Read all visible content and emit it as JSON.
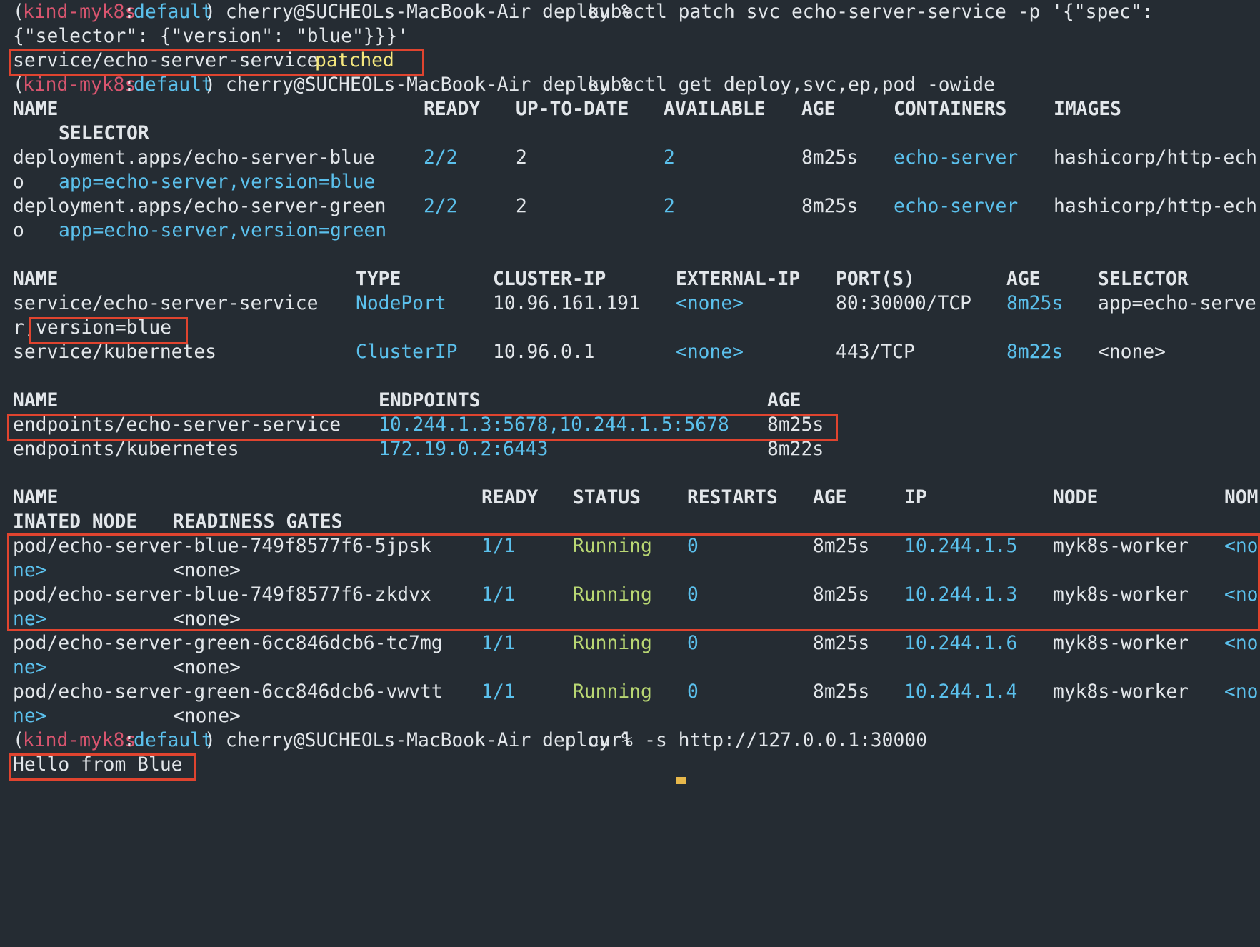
{
  "prompt": {
    "ctx_open": "(",
    "ctx_name": "kind-myk8s",
    "ctx_sep": ":",
    "ctx_ns": "default",
    "ctx_close": ")",
    "user_dir": " cherry@SUCHEOLs-MacBook-Air deploy % "
  },
  "commands": {
    "patch_line1": "kubectl patch svc echo-server-service -p '{\"spec\":",
    "patch_line2": "{\"selector\": {\"version\": \"blue\"}}}'",
    "get": "kubectl get deploy,svc,ep,pod -owide",
    "curl": "curl -s http://127.0.0.1:30000"
  },
  "patch_result": {
    "resource": "service/echo-server-service ",
    "status": "patched"
  },
  "deploy": {
    "headers": [
      "NAME",
      "READY",
      "UP-TO-DATE",
      "AVAILABLE",
      "AGE",
      "CONTAINERS",
      "IMAGES"
    ],
    "header_wrap": "SELECTOR",
    "rows": [
      {
        "name": "deployment.apps/echo-server-blue",
        "ready": "2/2",
        "uptodate": "2",
        "available": "2",
        "age": "8m25s",
        "containers": "echo-server",
        "images": "hashicorp/http-ech",
        "wrap_prefix": "o",
        "selector": "app=echo-server,version=blue"
      },
      {
        "name": "deployment.apps/echo-server-green",
        "ready": "2/2",
        "uptodate": "2",
        "available": "2",
        "age": "8m25s",
        "containers": "echo-server",
        "images": "hashicorp/http-ech",
        "wrap_prefix": "o",
        "selector": "app=echo-server,version=green"
      }
    ]
  },
  "svc": {
    "headers": [
      "NAME",
      "TYPE",
      "CLUSTER-IP",
      "EXTERNAL-IP",
      "PORT(S)",
      "AGE",
      "SELECTOR"
    ],
    "rows": [
      {
        "name": "service/echo-server-service",
        "type": "NodePort",
        "cluster_ip": "10.96.161.191",
        "external_ip": "<none>",
        "ports": "80:30000/TCP",
        "age": "8m25s",
        "selector": "app=echo-serve",
        "wrap_prefix": "r,",
        "wrap_rest": "version=blue"
      },
      {
        "name": "service/kubernetes",
        "type": "ClusterIP",
        "cluster_ip": "10.96.0.1",
        "external_ip": "<none>",
        "ports": "443/TCP",
        "age": "8m22s",
        "selector": "<none>"
      }
    ]
  },
  "ep": {
    "headers": [
      "NAME",
      "ENDPOINTS",
      "AGE"
    ],
    "rows": [
      {
        "name": "endpoints/echo-server-service",
        "endpoints": "10.244.1.3:5678,10.244.1.5:5678",
        "age": "8m25s"
      },
      {
        "name": "endpoints/kubernetes",
        "endpoints": "172.19.0.2:6443",
        "age": "8m22s"
      }
    ]
  },
  "pods": {
    "headers": [
      "NAME",
      "READY",
      "STATUS",
      "RESTARTS",
      "AGE",
      "IP",
      "NODE",
      "NOM"
    ],
    "header_wrap_1": "INATED NODE",
    "header_wrap_2": "READINESS GATES",
    "rows": [
      {
        "name": "pod/echo-server-blue-749f8577f6-5jpsk",
        "ready": "1/1",
        "status": "Running",
        "restarts": "0",
        "age": "8m25s",
        "ip": "10.244.1.5",
        "node": "myk8s-worker",
        "nominated": "<no",
        "wrap_nominated": "ne>",
        "readiness": "<none>"
      },
      {
        "name": "pod/echo-server-blue-749f8577f6-zkdvx",
        "ready": "1/1",
        "status": "Running",
        "restarts": "0",
        "age": "8m25s",
        "ip": "10.244.1.3",
        "node": "myk8s-worker",
        "nominated": "<no",
        "wrap_nominated": "ne>",
        "readiness": "<none>"
      },
      {
        "name": "pod/echo-server-green-6cc846dcb6-tc7mg",
        "ready": "1/1",
        "status": "Running",
        "restarts": "0",
        "age": "8m25s",
        "ip": "10.244.1.6",
        "node": "myk8s-worker",
        "nominated": "<no",
        "wrap_nominated": "ne>",
        "readiness": "<none>"
      },
      {
        "name": "pod/echo-server-green-6cc846dcb6-vwvtt",
        "ready": "1/1",
        "status": "Running",
        "restarts": "0",
        "age": "8m25s",
        "ip": "10.244.1.4",
        "node": "myk8s-worker",
        "nominated": "<no",
        "wrap_nominated": "ne>",
        "readiness": "<none>"
      }
    ]
  },
  "curl_output": "Hello from Blue",
  "colors": {
    "background": "#252c33",
    "text": "#e2e6ea",
    "cyan": "#5bc0ec",
    "context": "#d9556f",
    "running": "#b9d773",
    "patched": "#f4e77e",
    "highlight_box": "#e0442f",
    "cursor": "#e7b84b"
  }
}
